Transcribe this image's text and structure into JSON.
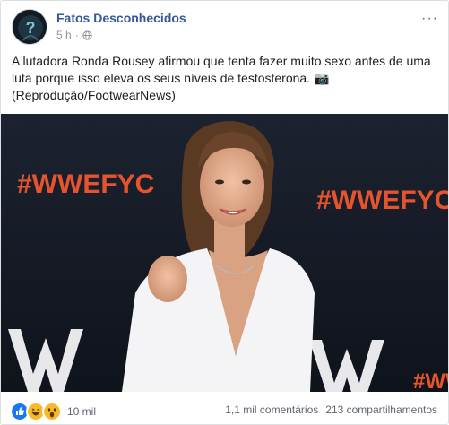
{
  "post": {
    "author": "Fatos Desconhecidos",
    "time": "5 h",
    "separator": "·",
    "more": "···",
    "text_line1": "A lutadora Ronda Rousey afirmou que tenta fazer muito sexo antes de uma",
    "text_line2": "luta porque isso eleva os seus níveis de testosterona. 📷",
    "text_line3": "(Reprodução/FootwearNews)"
  },
  "photo": {
    "backdrop_text": "#WWEFYC",
    "brand_color": "#e5542e"
  },
  "reactions": {
    "types": [
      "like-icon",
      "haha-icon",
      "wow-icon"
    ],
    "count": "10 mil",
    "comments": "1,1 mil comentários",
    "shares": "213 compartilhamentos"
  },
  "colors": {
    "link": "#365899",
    "like": "#1877f2",
    "emoji": "#f7b928",
    "meta": "#90949c"
  }
}
